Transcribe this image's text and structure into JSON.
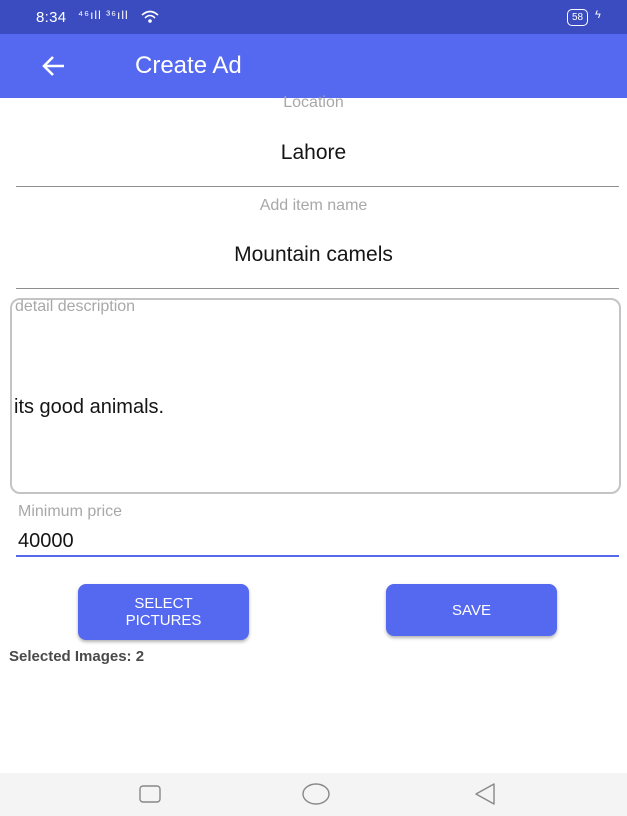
{
  "status_bar": {
    "time": "8:34",
    "signal_text": "⁴⁶ıll ³⁶ıll",
    "battery": "58",
    "wifi_icon": "wifi-icon",
    "charging_icon": "bolt-icon"
  },
  "app_bar": {
    "title": "Create Ad",
    "back_icon": "arrow-left-icon",
    "color": "#5468f0"
  },
  "form": {
    "location": {
      "label": "Location",
      "value": "Lahore"
    },
    "item_name": {
      "label": "Add item name",
      "value": "Mountain camels"
    },
    "description": {
      "label": "detail description",
      "value": "its good animals."
    },
    "price": {
      "label": "Minimum price",
      "value": "40000"
    }
  },
  "buttons": {
    "select_pictures": "SELECT\nPICTURES",
    "save": "SAVE"
  },
  "selected_images": "Selected Images: 2",
  "nav": {
    "recents_icon": "square-icon",
    "home_icon": "circle-icon",
    "back_icon": "triangle-back-icon"
  }
}
